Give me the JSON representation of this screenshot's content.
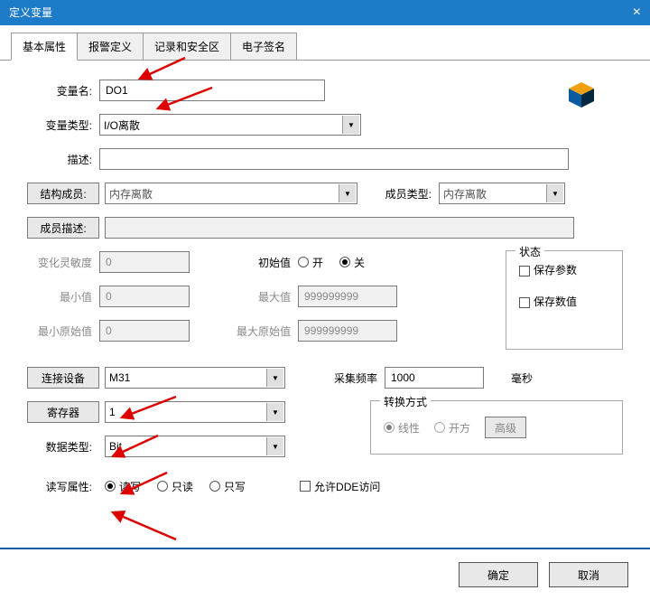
{
  "window": {
    "title": "定义变量"
  },
  "tabs": [
    "基本属性",
    "报警定义",
    "记录和安全区",
    "电子签名"
  ],
  "active_tab": 0,
  "labels": {
    "var_name": "变量名:",
    "var_type": "变量类型:",
    "description": "描述:",
    "struct_member": "结构成员:",
    "member_type": "成员类型:",
    "member_desc": "成员描述:",
    "sensitivity": "变化灵敏度",
    "init_val": "初始值",
    "min_val": "最小值",
    "max_val": "最大值",
    "min_raw": "最小原始值",
    "max_raw": "最大原始值",
    "connect_device": "连接设备",
    "sample_freq": "采集频率",
    "ms": "毫秒",
    "register": "寄存器",
    "data_type": "数据类型:",
    "rw_attr": "读写属性:",
    "status": "状态",
    "save_params": "保存参数",
    "save_value": "保存数值",
    "convert": "转换方式",
    "linear": "线性",
    "sqrt": "开方",
    "advanced": "高级",
    "allow_dde": "允许DDE访问",
    "on": "开",
    "off": "关",
    "rw": "读写",
    "ro": "只读",
    "wo": "只写",
    "ok": "确定",
    "cancel": "取消"
  },
  "values": {
    "var_name": "DO1",
    "var_type": "I/O离散",
    "description": "",
    "struct_member": "内存离散",
    "member_type": "内存离散",
    "sensitivity": "0",
    "min_val": "0",
    "min_raw": "0",
    "max_val": "999999999",
    "max_raw": "999999999",
    "device": "M31",
    "sample_freq": "1000",
    "register": "1",
    "data_type": "Bit",
    "init_val": "off",
    "rw": "rw",
    "save_params": false,
    "save_value": false,
    "allow_dde": false,
    "convert": "linear"
  }
}
